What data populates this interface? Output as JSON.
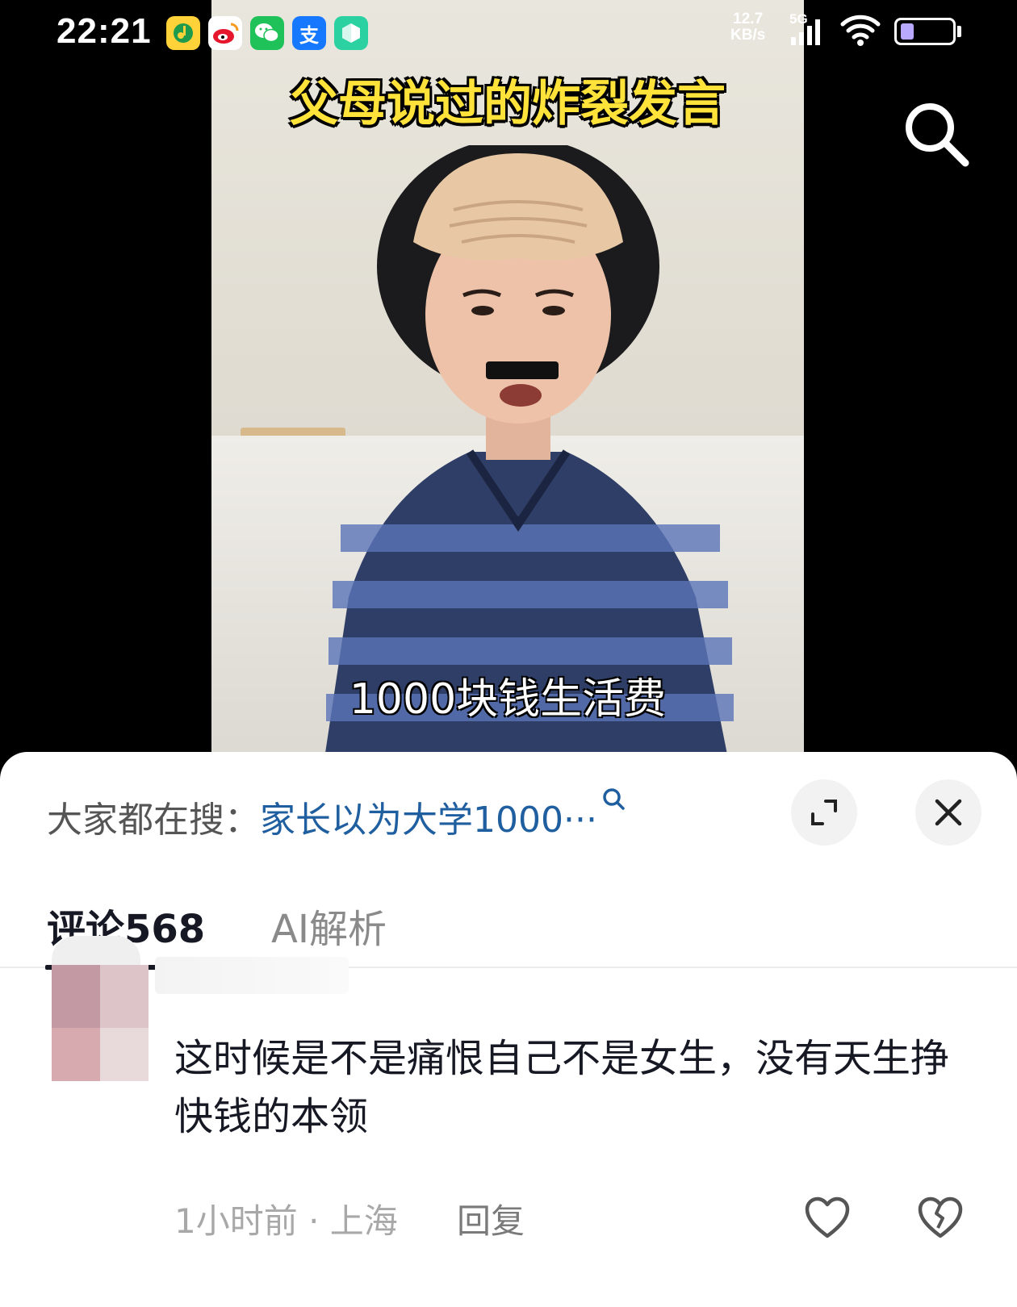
{
  "status_bar": {
    "time": "22:21",
    "net_speed_value": "12.7",
    "net_speed_unit": "KB/s",
    "network_type": "5G",
    "battery_level": 0.25,
    "app_icons": [
      {
        "name": "qq-music-icon",
        "color": "#ffd23a"
      },
      {
        "name": "weibo-icon",
        "color": "#ffffff"
      },
      {
        "name": "wechat-icon",
        "color": "#1fc159"
      },
      {
        "name": "alipay-icon",
        "color": "#1677ff",
        "glyph": "支"
      },
      {
        "name": "app-store-icon",
        "color": "#2bd1a1"
      }
    ]
  },
  "video": {
    "title_overlay": "父母说过的炸裂发言",
    "subtitle_overlay": "1000块钱生活费"
  },
  "sheet": {
    "hot_search_prefix": "大家都在搜：",
    "hot_search_query": "家长以为大学1000···",
    "tabs": [
      {
        "label": "评论568",
        "active": true
      },
      {
        "label": "AI解析",
        "active": false
      }
    ]
  },
  "comment": {
    "text": "这时候是不是痛恨自己不是女生，没有天生挣快钱的本领",
    "meta": "1小时前 · 上海",
    "reply_label": "回复"
  },
  "colors": {
    "link": "#1f5fa0",
    "video_title": "#ffe33a",
    "battery": "#b8a9ff"
  }
}
